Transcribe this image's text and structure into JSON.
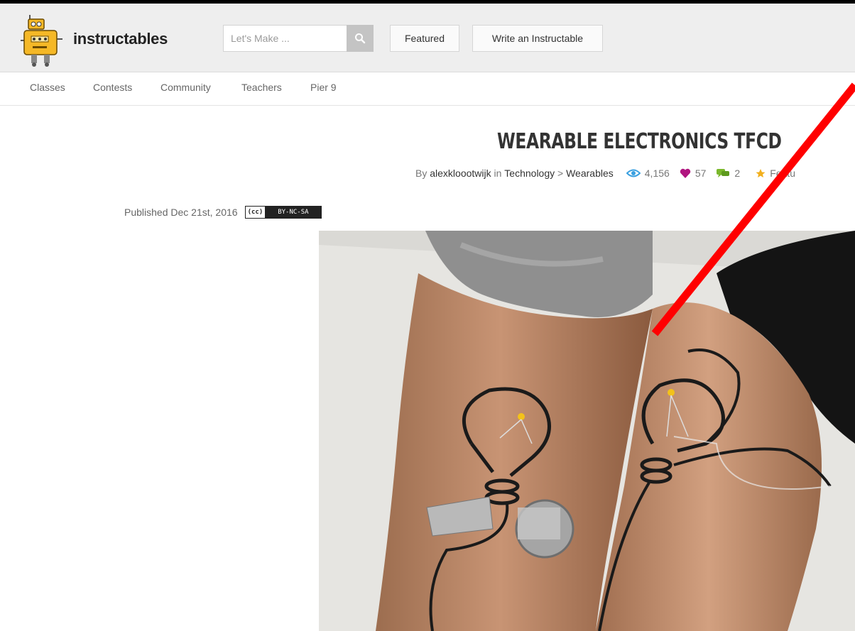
{
  "header": {
    "brand": "instructables",
    "search_placeholder": "Let's Make ...",
    "featured_label": "Featured",
    "write_label": "Write an Instructable"
  },
  "subnav": {
    "items": [
      "Classes",
      "Contests",
      "Community",
      "Teachers",
      "Pier 9"
    ]
  },
  "article": {
    "title": "WEARABLE ELECTRONICS TFCD",
    "by": "By",
    "author": "alexkloootwijk",
    "in": "in",
    "category": "Technology",
    "separator": ">",
    "subcategory": "Wearables",
    "views": "4,156",
    "favorites": "57",
    "comments": "2",
    "featured_partial": "Featu",
    "published": "Published Dec 21st, 2016",
    "license_cc": "(cc)",
    "license": "BY-NC-SA"
  },
  "colors": {
    "views_icon": "#3aa0e0",
    "heart_icon": "#b0157f",
    "comment_icon": "#7ab82c",
    "annotation_line": "#ff0000"
  }
}
